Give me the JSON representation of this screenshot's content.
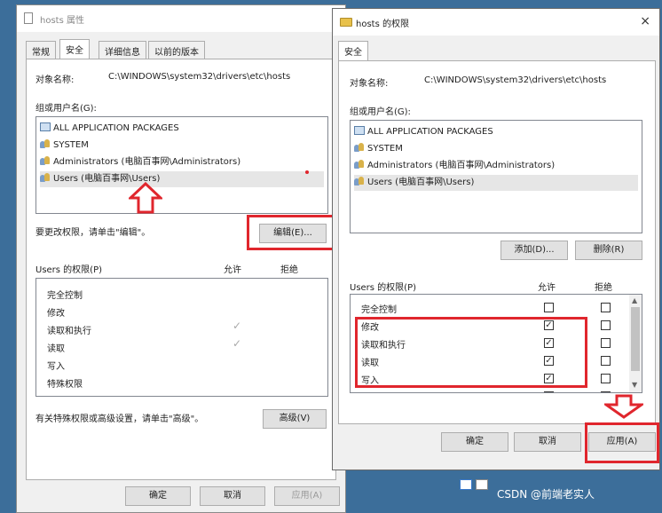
{
  "left_window": {
    "title": "hosts 属性",
    "tabs": [
      "常规",
      "安全",
      "详细信息",
      "以前的版本"
    ],
    "object_label": "对象名称:",
    "object_path": "C:\\WINDOWS\\system32\\drivers\\etc\\hosts",
    "group_label": "组或用户名(G):",
    "groups": [
      "ALL APPLICATION PACKAGES",
      "SYSTEM",
      "Administrators (电脑百事网\\Administrators)",
      "Users (电脑百事网\\Users)"
    ],
    "edit_hint": "要更改权限，请单击\"编辑\"。",
    "edit_button": "编辑(E)...",
    "perm_header": "Users 的权限(P)",
    "allow_header": "允许",
    "deny_header": "拒绝",
    "permissions": [
      "完全控制",
      "修改",
      "读取和执行",
      "读取",
      "写入",
      "特殊权限"
    ],
    "adv_hint": "有关特殊权限或高级设置，请单击\"高级\"。",
    "advanced_button": "高级(V)",
    "ok_button": "确定",
    "cancel_button": "取消",
    "apply_button": "应用(A)"
  },
  "right_window": {
    "title": "hosts 的权限",
    "close_icon": "×",
    "tab": "安全",
    "object_label": "对象名称:",
    "object_path": "C:\\WINDOWS\\system32\\drivers\\etc\\hosts",
    "group_label": "组或用户名(G):",
    "groups": [
      "ALL APPLICATION PACKAGES",
      "SYSTEM",
      "Administrators (电脑百事网\\Administrators)",
      "Users (电脑百事网\\Users)"
    ],
    "add_button": "添加(D)...",
    "remove_button": "删除(R)",
    "perm_header": "Users 的权限(P)",
    "allow_header": "允许",
    "deny_header": "拒绝",
    "permissions": [
      {
        "name": "完全控制",
        "allow": false,
        "deny": false
      },
      {
        "name": "修改",
        "allow": true,
        "deny": false
      },
      {
        "name": "读取和执行",
        "allow": true,
        "deny": false
      },
      {
        "name": "读取",
        "allow": true,
        "deny": false
      },
      {
        "name": "写入",
        "allow": true,
        "deny": false
      },
      {
        "name": "特殊权限",
        "allow": false,
        "deny": false
      }
    ],
    "ok_button": "确定",
    "cancel_button": "取消",
    "apply_button": "应用(A)"
  },
  "watermark": "CSDN @前端老实人",
  "colors": {
    "highlight": "#e0262d",
    "desktop": "#3c6e9a"
  }
}
